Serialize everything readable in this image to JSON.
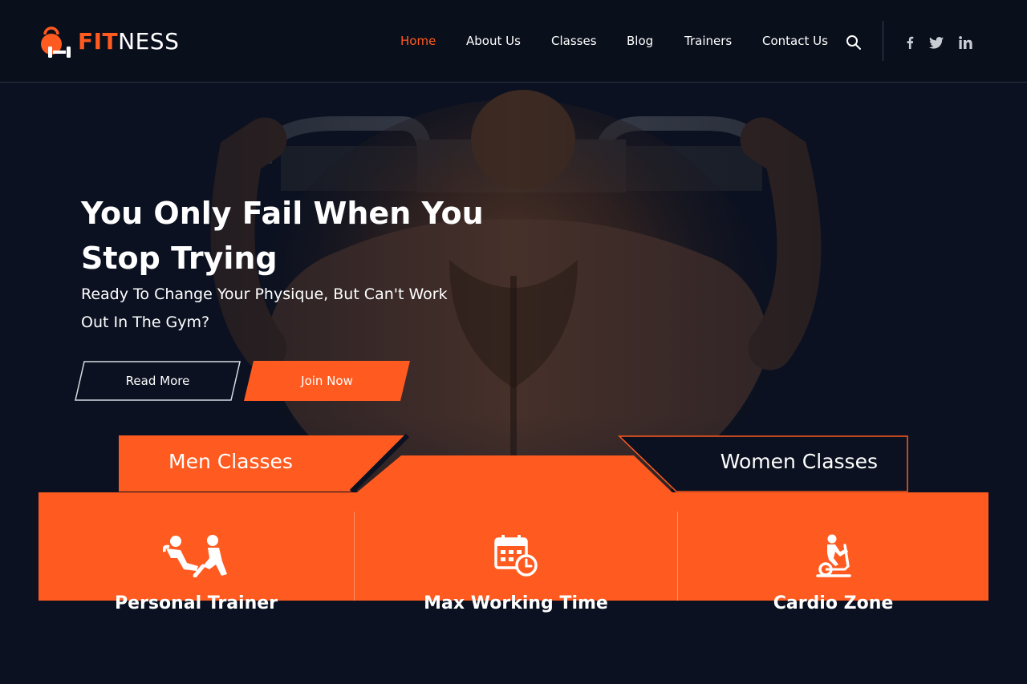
{
  "brand": {
    "accent": "FIT",
    "rest": "NESS",
    "color": "#ff5a1f"
  },
  "nav": {
    "items": [
      {
        "label": "Home",
        "active": true
      },
      {
        "label": "About Us"
      },
      {
        "label": "Classes"
      },
      {
        "label": "Blog"
      },
      {
        "label": "Trainers"
      },
      {
        "label": "Contact Us"
      }
    ],
    "search_icon": "search-icon",
    "social": [
      "facebook-icon",
      "twitter-icon",
      "linkedin-icon"
    ]
  },
  "hero": {
    "title_line1": "You Only Fail When You",
    "title_line2": "Stop Trying",
    "subtitle_line1": "Ready To Change Your Physique, But Can't Work",
    "subtitle_line2": "Out In The Gym?",
    "read_more": "Read More",
    "join_now": "Join Now"
  },
  "classes": {
    "men_tab": "Men Classes",
    "women_tab": "Women Classes",
    "features": [
      {
        "label": "Personal Trainer",
        "icon": "trainer-icon"
      },
      {
        "label": "Max Working Time",
        "icon": "calendar-clock-icon"
      },
      {
        "label": "Cardio Zone",
        "icon": "exercise-bike-icon"
      }
    ]
  },
  "colors": {
    "accent": "#ff5a1f",
    "background": "#0b1120"
  }
}
